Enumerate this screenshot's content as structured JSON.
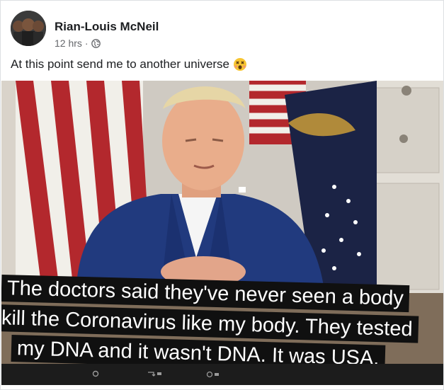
{
  "post": {
    "author": "Rian-Louis McNeil",
    "time": "12 hrs",
    "separator": "·",
    "privacy_icon": "globe-icon",
    "caption": "At this point send me to another universe",
    "caption_emoji": "dizzy-face-emoji"
  },
  "image": {
    "subtitle_lines": [
      "The doctors said they've never seen a body",
      "kill the Coronavirus like my body. They tested",
      "my DNA and it wasn't DNA. It was USA."
    ]
  },
  "colors": {
    "text_primary": "#1c1e21",
    "text_secondary": "#65676b",
    "suit": "#1f3576",
    "subtitle_bg": "#101010"
  }
}
